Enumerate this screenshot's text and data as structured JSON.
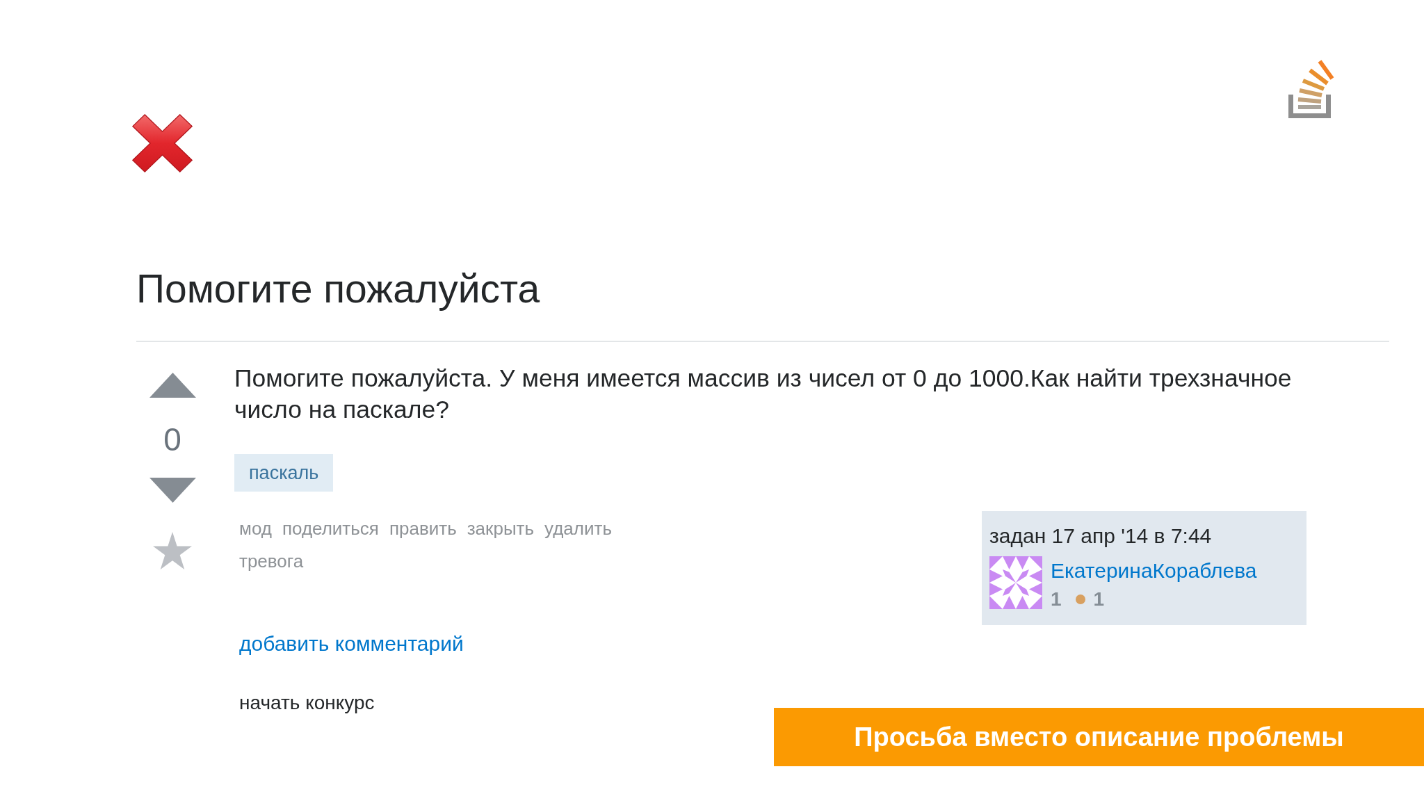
{
  "question": {
    "title": "Помогите пожалуйста",
    "votes": "0",
    "body": "Помогите пожалуйста. У меня имеется массив из чисел от 0 до 1000.Как найти трехзначное число на паскале?",
    "tags": [
      "паскаль"
    ],
    "actions": [
      "мод",
      "поделиться",
      "править",
      "закрыть",
      "удалить",
      "тревога"
    ],
    "asked": {
      "label": "задан 17 апр '14 в 7:44",
      "user": "ЕкатеринаКораблева",
      "reputation": "1",
      "badges": [
        {
          "count": "1",
          "color": "#d8a060"
        }
      ]
    },
    "add_comment": "добавить комментарий",
    "start_bounty": "начать конкурс"
  },
  "banner": {
    "text": "Просьба вместо описание проблемы"
  }
}
